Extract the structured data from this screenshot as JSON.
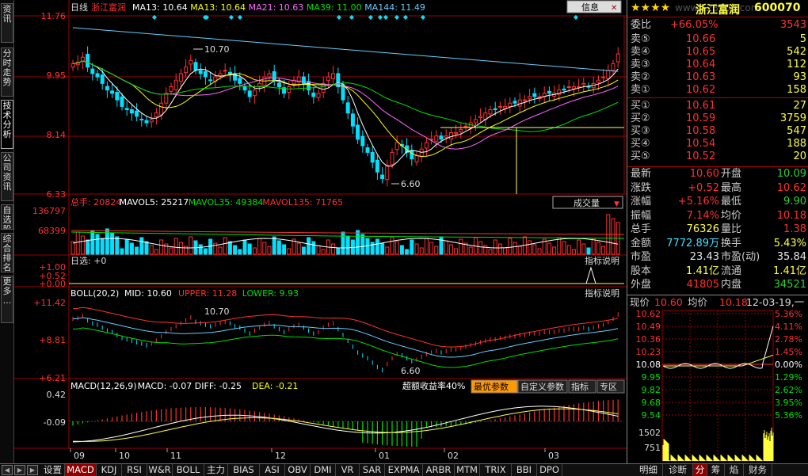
{
  "stock": {
    "name": "浙江富润",
    "code": "600070",
    "stars": "★★★★",
    "watermark": "www.123100.com"
  },
  "toolbar": {
    "info_label": "信息",
    "period": "日线"
  },
  "ma_legend": [
    {
      "label": "MA13: 10.64",
      "color": "#ffffff"
    },
    {
      "label": "MA13: 10.64",
      "color": "#ffff00"
    },
    {
      "label": "MA21: 10.63",
      "color": "#ff66ff"
    },
    {
      "label": "MA39: 11.00",
      "color": "#00e000"
    },
    {
      "label": "MA144: 11.49",
      "color": "#66ccff"
    }
  ],
  "price_axis": [
    "11.76",
    "9.95",
    "8.14",
    "6.33"
  ],
  "price_annot": {
    "high": "10.70",
    "low": "6.60"
  },
  "volume": {
    "legend": [
      {
        "label": "总手: 20824",
        "color": "#ff3030"
      },
      {
        "label": "MAVOL5: 25217",
        "color": "#ffffff"
      },
      {
        "label": "MAVOL35: 49384",
        "color": "#00e000"
      },
      {
        "label": "MAVOL135: 71765",
        "color": "#ff3030"
      }
    ],
    "axis": [
      "136797",
      "68399"
    ],
    "dropdown": "成交量"
  },
  "rixuan": {
    "label": "日选: +0",
    "axis": [
      "+1.00",
      "+0.52",
      "+0.00"
    ],
    "button": "指标说明"
  },
  "boll": {
    "legend": [
      {
        "label": "BOLL(20,2)",
        "color": "#ffffff"
      },
      {
        "label": "MID: 10.60",
        "color": "#ffffff"
      },
      {
        "label": "UPPER: 11.28",
        "color": "#ff3030"
      },
      {
        "label": "LOWER: 9.93",
        "color": "#00e000"
      }
    ],
    "axis": [
      "+11.42",
      "+8.81",
      "+6.21"
    ],
    "button": "指标说明",
    "annot_high": "10.70",
    "annot_low": "6.60"
  },
  "macd": {
    "legend": [
      {
        "label": "MACD(12,26,9)",
        "color": "#ffffff"
      },
      {
        "label": "MACD: -0.07",
        "color": "#ffffff"
      },
      {
        "label": "DIFF: -0.25",
        "color": "#ffffff"
      },
      {
        "label": "DEA: -0.21",
        "color": "#ffff00"
      }
    ],
    "axis": [
      "0.42",
      "-0.09"
    ],
    "note": "超额收益率40%",
    "buttons": [
      "最优参数",
      "自定义参数",
      "指标",
      "专区"
    ]
  },
  "x_axis": [
    "09",
    "10",
    "11",
    "12",
    "01",
    "02",
    "03"
  ],
  "quote": {
    "weibi_label": "委比",
    "weibi": "+66.05%",
    "weibi_vol": "3543",
    "sells": [
      {
        "label": "卖⑤",
        "price": "10.66",
        "vol": "5"
      },
      {
        "label": "卖④",
        "price": "10.65",
        "vol": "542"
      },
      {
        "label": "卖③",
        "price": "10.64",
        "vol": "112"
      },
      {
        "label": "卖②",
        "price": "10.63",
        "vol": "93"
      },
      {
        "label": "卖①",
        "price": "10.62",
        "vol": "158"
      }
    ],
    "buys": [
      {
        "label": "买①",
        "price": "10.61",
        "vol": "27"
      },
      {
        "label": "买②",
        "price": "10.59",
        "vol": "3759"
      },
      {
        "label": "买③",
        "price": "10.58",
        "vol": "547"
      },
      {
        "label": "买④",
        "price": "10.54",
        "vol": "188"
      },
      {
        "label": "买⑤",
        "price": "10.52",
        "vol": "20"
      }
    ],
    "stats": [
      {
        "l1": "最新",
        "v1": "10.60",
        "c1": "up",
        "l2": "开盘",
        "v2": "10.09",
        "c2": "dn"
      },
      {
        "l1": "涨跌",
        "v1": "+0.52",
        "c1": "up",
        "l2": "最高",
        "v2": "10.62",
        "c2": "up"
      },
      {
        "l1": "涨幅",
        "v1": "+5.16%",
        "c1": "up",
        "l2": "最低",
        "v2": "9.90",
        "c2": "dn"
      },
      {
        "l1": "振幅",
        "v1": "7.14%",
        "c1": "up",
        "l2": "均价",
        "v2": "10.18",
        "c2": "up"
      },
      {
        "l1": "总手",
        "v1": "76326",
        "c1": "yl",
        "l2": "量比",
        "v2": "1.38",
        "c2": "up"
      },
      {
        "l1": "金额",
        "v1": "7772.89万",
        "c1": "cy",
        "l2": "换手",
        "v2": "5.43%",
        "c2": "yl"
      },
      {
        "l1": "市盈",
        "v1": "23.43",
        "c1": "wh",
        "l2": "市盈(动)",
        "v2": "35.84",
        "c2": "wh"
      },
      {
        "l1": "股本",
        "v1": "1.41亿",
        "c1": "yl",
        "l2": "流通",
        "v2": "1.41亿",
        "c2": "yl"
      },
      {
        "l1": "外盘",
        "v1": "41805",
        "c1": "up",
        "l2": "内盘",
        "v2": "34521",
        "c2": "dn"
      }
    ]
  },
  "minute": {
    "header": {
      "now_label": "现价",
      "now": "10.60",
      "avg_label": "均价",
      "avg": "10.18",
      "date": "12-03-19,一"
    },
    "prices": [
      "10.62",
      "10.49",
      "10.36",
      "10.23",
      "10.08",
      "9.95",
      "9.82",
      "9.68",
      "9.54"
    ],
    "pcts": [
      "5.36%",
      "4.11%",
      "2.78%",
      "1.45%",
      "0.00%",
      "1.29%",
      "2.62%",
      "3.95%",
      "5.36%"
    ],
    "vol_axis": [
      "1502",
      "751"
    ]
  },
  "right_tabs": [
    "明细",
    "诊断",
    "分",
    "筹",
    "焰",
    "财务"
  ],
  "left_tabs": [
    {
      "label": "资讯"
    },
    {
      "label": "分时走势"
    },
    {
      "label": "技术分析"
    },
    {
      "label": "公司资讯"
    },
    {
      "label": "自选股"
    },
    {
      "label": "综合排名"
    },
    {
      "label": "更多..."
    }
  ],
  "bottom_tabs": [
    "设置",
    "MACD",
    "KDJ",
    "RSI",
    "W&R",
    "BOLL",
    "主力",
    "BIAS",
    "ASI",
    "OBV",
    "DMI",
    "VR",
    "SAR",
    "EXPMA",
    "ARBR",
    "MTM",
    "TRIX",
    "BBI",
    "DPO"
  ],
  "colors": {
    "up": "#ff3030",
    "down": "#00e0ff",
    "grid": "#9b0000"
  }
}
